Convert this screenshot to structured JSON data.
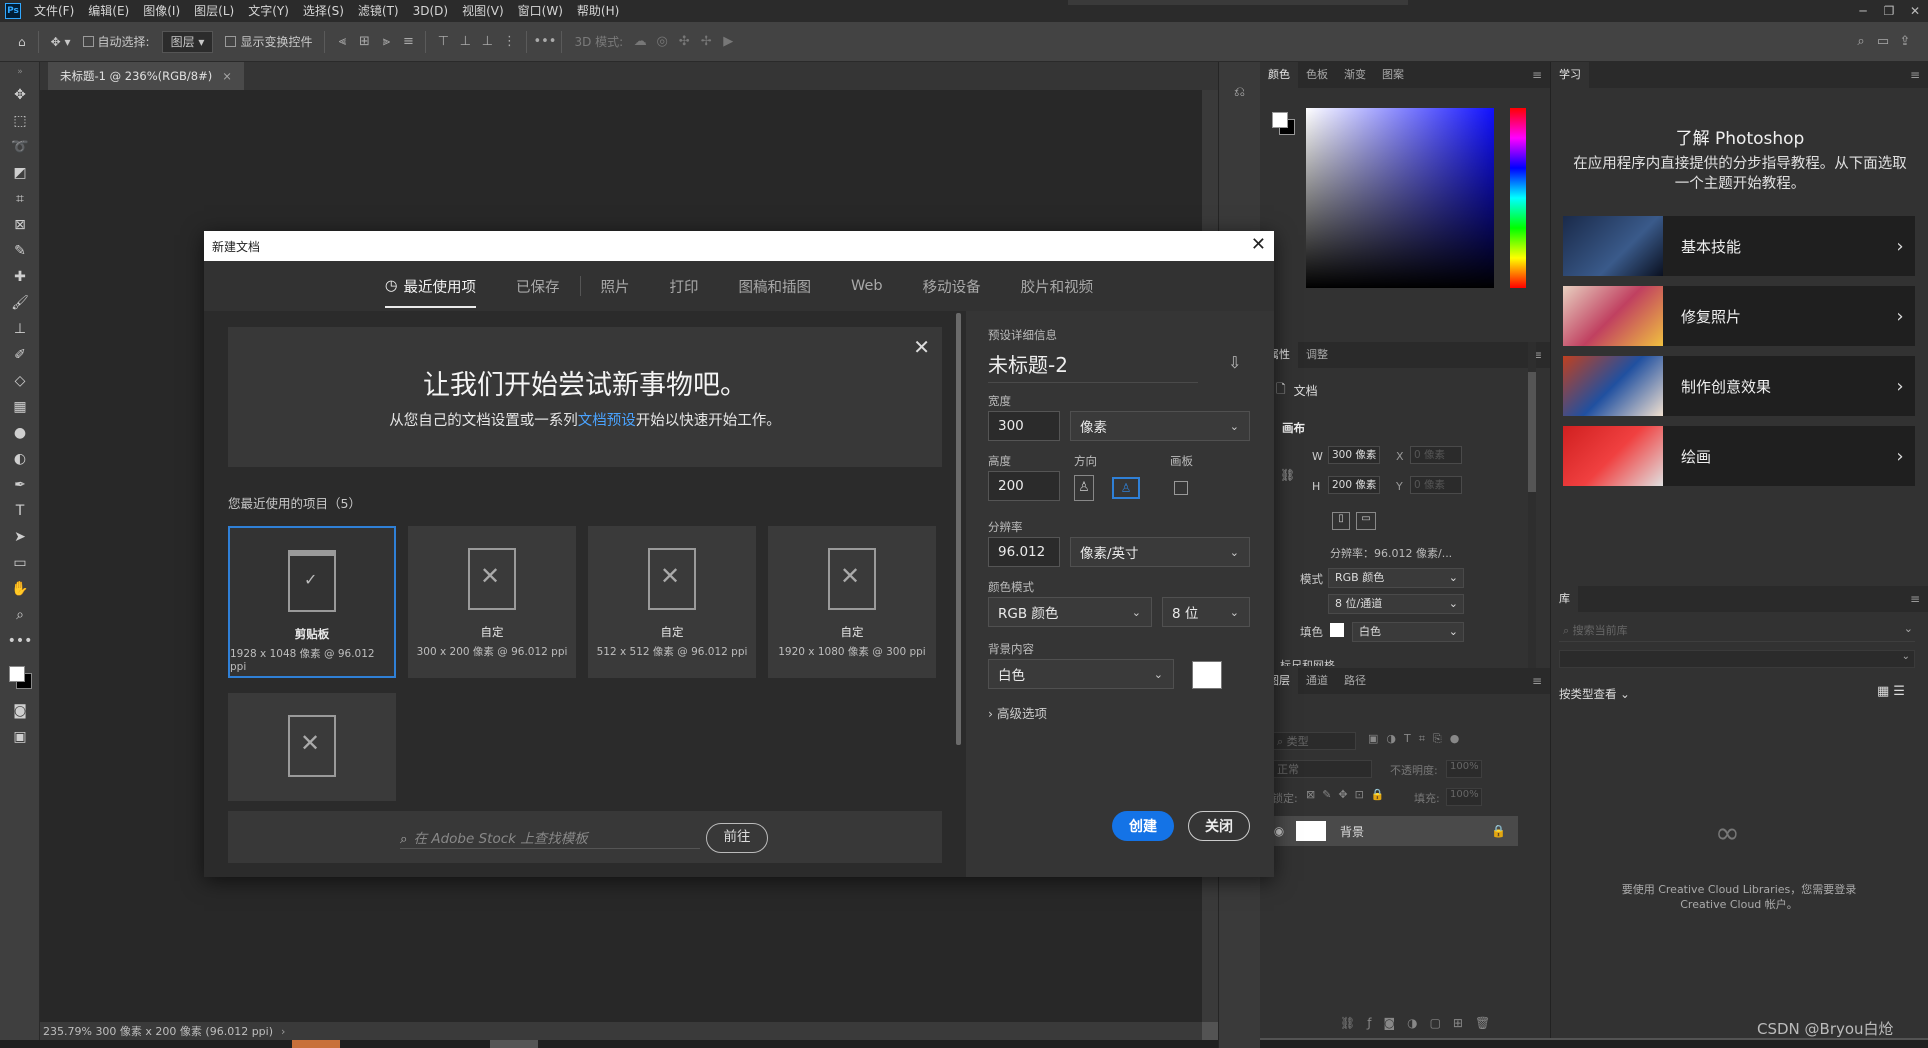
{
  "menu": {
    "logo": "Ps",
    "items": [
      "文件(F)",
      "编辑(E)",
      "图像(I)",
      "图层(L)",
      "文字(Y)",
      "选择(S)",
      "滤镜(T)",
      "3D(D)",
      "视图(V)",
      "窗口(W)",
      "帮助(H)"
    ]
  },
  "options": {
    "auto_select": "自动选择:",
    "auto_select_value": "图层",
    "show_transform": "显示变换控件",
    "mode3d": "3D 模式:"
  },
  "doc_tab": {
    "title": "未标题-1 @ 236%(RGB/8#)",
    "close": "×"
  },
  "status": {
    "text": "235.79%  300 像素 x 200 像素 (96.012 ppi)"
  },
  "dialog": {
    "title": "新建文档",
    "tabs": [
      "最近使用项",
      "已保存",
      "照片",
      "打印",
      "图稿和插图",
      "Web",
      "移动设备",
      "胶片和视频"
    ],
    "hero_title": "让我们开始尝试新事物吧。",
    "hero_sub_before": "从您自己的文档设置或一系列",
    "hero_link": "文档预设",
    "hero_sub_after": "开始以快速开始工作。",
    "recents_label": "您最近使用的项目（5）",
    "recents": [
      {
        "name": "剪贴板",
        "desc": "1928 x 1048 像素 @ 96.012 ppi"
      },
      {
        "name": "自定",
        "desc": "300 x 200 像素 @ 96.012 ppi"
      },
      {
        "name": "自定",
        "desc": "512 x 512 像素 @ 96.012 ppi"
      },
      {
        "name": "自定",
        "desc": "1920 x 1080 像素 @ 300 ppi"
      },
      {
        "name": "",
        "desc": ""
      }
    ],
    "stock_placeholder": "在 Adobe Stock 上查找模板",
    "stock_go": "前往",
    "preset_label": "预设详细信息",
    "doc_name": "未标题-2",
    "width_label": "宽度",
    "width_value": "300",
    "width_unit": "像素",
    "height_label": "高度",
    "height_value": "200",
    "orientation_label": "方向",
    "artboard_label": "画板",
    "resolution_label": "分辨率",
    "resolution_value": "96.012",
    "resolution_unit": "像素/英寸",
    "colormode_label": "颜色模式",
    "colormode_value": "RGB 颜色",
    "bitdepth_value": "8 位",
    "bg_label": "背景内容",
    "bg_value": "白色",
    "advanced": "高级选项",
    "create": "创建",
    "close": "关闭"
  },
  "color_panel": {
    "tabs": [
      "颜色",
      "色板",
      "渐变",
      "图案"
    ]
  },
  "props_panel": {
    "tabs": [
      "属性",
      "调整"
    ],
    "doc_label": "文档",
    "canvas_label": "画布",
    "w_label": "W",
    "w_value": "300 像素",
    "h_label": "H",
    "h_value": "200 像素",
    "x_label": "X",
    "x_placeholder": "0 像素",
    "y_label": "Y",
    "y_placeholder": "0 像素",
    "resolution": "分辨率：96.012 像素/...",
    "mode_label": "模式",
    "mode_value": "RGB 颜色",
    "depth_value": "8 位/通道",
    "fill_label": "填色",
    "fill_value": "白色",
    "cut_label": "标尺和网格"
  },
  "layers_panel": {
    "tabs": [
      "图层",
      "通道",
      "路径"
    ],
    "kind_placeholder": "类型",
    "blend": "正常",
    "opacity_label": "不透明度:",
    "opacity_value": "100%",
    "lock_label": "锁定:",
    "fill_label": "填充:",
    "fill_value": "100%",
    "layer_name": "背景"
  },
  "learn_panel": {
    "tab": "学习",
    "title": "了解 Photoshop",
    "desc": "在应用程序内直接提供的分步指导教程。从下面选取一个主题开始教程。",
    "cards": [
      "基本技能",
      "修复照片",
      "制作创意效果",
      "绘画"
    ]
  },
  "library_panel": {
    "tab": "库",
    "search_placeholder": "搜索当前库",
    "view_label": "按类型查看",
    "message": "要使用 Creative Cloud Libraries，您需要登录 Creative Cloud 帐户。"
  },
  "watermark": "CSDN @Bryou白炝",
  "colors": {
    "accent": "#1473e6",
    "selection": "#2f80d7",
    "link": "#4aa3ff"
  }
}
